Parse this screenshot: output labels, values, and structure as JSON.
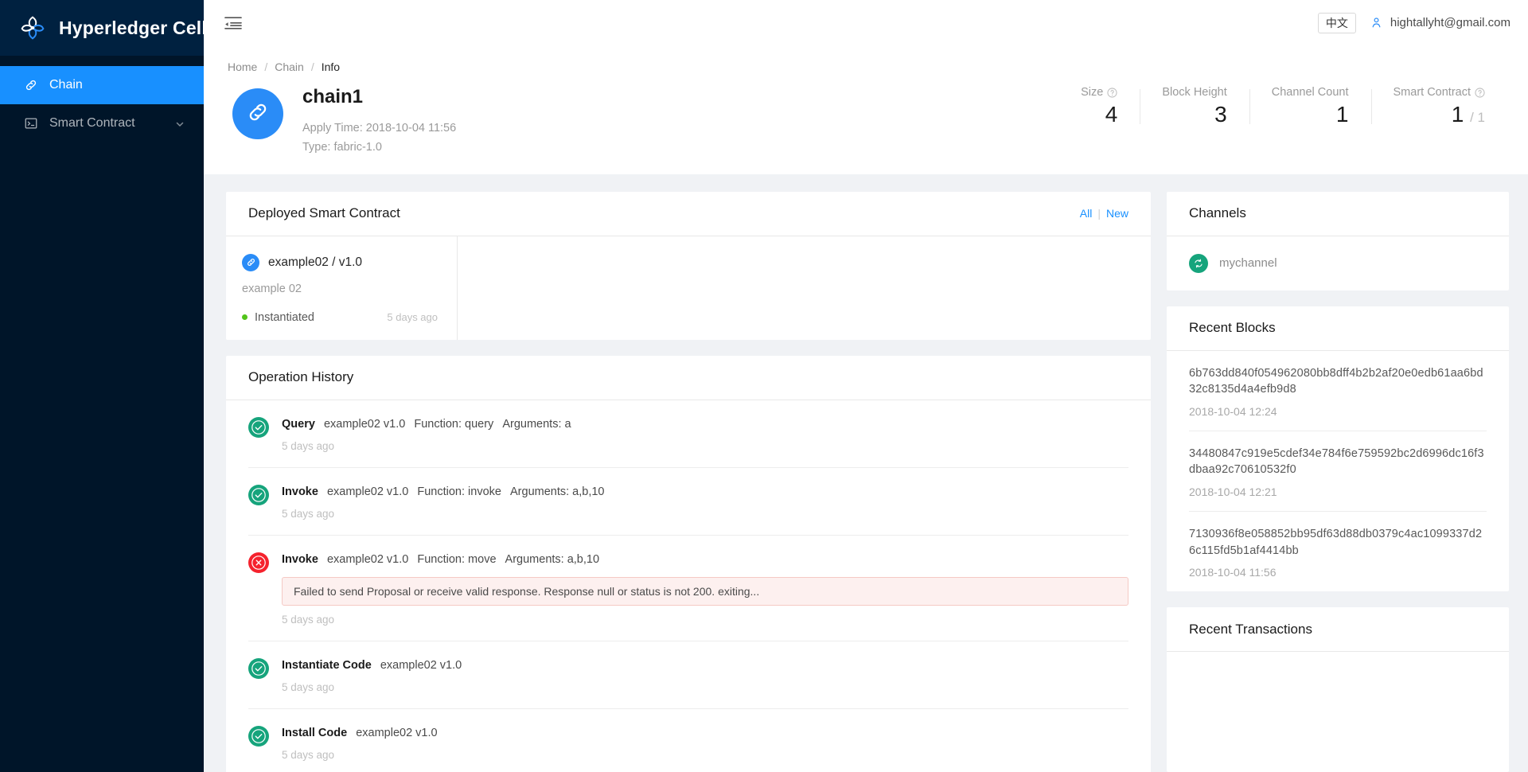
{
  "brand": {
    "title": "Hyperledger Cello",
    "logo_icon": "cello-logo-icon"
  },
  "sidebar": {
    "items": [
      {
        "label": "Chain",
        "icon": "link-icon",
        "active": true
      },
      {
        "label": "Smart Contract",
        "icon": "terminal-icon",
        "active": false,
        "chevron": "chevron-down-icon"
      }
    ]
  },
  "topbar": {
    "menu_icon": "hamburger-menu-icon",
    "lang_label": "中文",
    "user_icon": "user-icon",
    "user_email": "hightallyht@gmail.com"
  },
  "breadcrumb": {
    "items": [
      "Home",
      "Chain",
      "Info"
    ],
    "separator": "/"
  },
  "page_header": {
    "avatar_icon": "link-icon",
    "chain_name": "chain1",
    "apply_time": "Apply Time: 2018-10-04 11:56",
    "type": "Type: fabric-1.0",
    "stats": [
      {
        "label": "Size",
        "help": true,
        "value": "4",
        "sub": ""
      },
      {
        "label": "Block Height",
        "help": false,
        "value": "3",
        "sub": ""
      },
      {
        "label": "Channel Count",
        "help": false,
        "value": "1",
        "sub": ""
      },
      {
        "label": "Smart Contract",
        "help": true,
        "value": "1",
        "sub": "/ 1"
      }
    ]
  },
  "deployed": {
    "title": "Deployed Smart Contract",
    "link_all": "All",
    "link_sep": "|",
    "link_new": "New",
    "items": [
      {
        "icon": "link-icon",
        "name": "example02 / v1.0",
        "description": "example 02",
        "status": "Instantiated",
        "status_color": "#52c41a",
        "time": "5 days ago"
      }
    ]
  },
  "operation_history": {
    "title": "Operation History",
    "items": [
      {
        "icon": "check-circle-icon",
        "state": "success",
        "action": "Query",
        "target": "example02 v1.0",
        "function": "Function: query",
        "arguments": "Arguments: a",
        "error": "",
        "time": "5 days ago"
      },
      {
        "icon": "check-circle-icon",
        "state": "success",
        "action": "Invoke",
        "target": "example02 v1.0",
        "function": "Function: invoke",
        "arguments": "Arguments: a,b,10",
        "error": "",
        "time": "5 days ago"
      },
      {
        "icon": "close-circle-icon",
        "state": "error",
        "action": "Invoke",
        "target": "example02 v1.0",
        "function": "Function: move",
        "arguments": "Arguments: a,b,10",
        "error": "Failed to send Proposal or receive valid response. Response null or status is not 200. exiting...",
        "time": "5 days ago"
      },
      {
        "icon": "check-circle-icon",
        "state": "success",
        "action": "Instantiate Code",
        "target": "example02 v1.0",
        "function": "",
        "arguments": "",
        "error": "",
        "time": "5 days ago"
      },
      {
        "icon": "check-circle-icon",
        "state": "success",
        "action": "Install Code",
        "target": "example02 v1.0",
        "function": "",
        "arguments": "",
        "error": "",
        "time": "5 days ago"
      }
    ]
  },
  "channels": {
    "title": "Channels",
    "items": [
      {
        "icon": "sync-icon",
        "name": "mychannel"
      }
    ]
  },
  "recent_blocks": {
    "title": "Recent Blocks",
    "items": [
      {
        "hash": "6b763dd840f054962080bb8dff4b2b2af20e0edb61aa6bd32c8135d4a4efb9d8",
        "time": "2018-10-04 12:24"
      },
      {
        "hash": "34480847c919e5cdef34e784f6e759592bc2d6996dc16f3dbaa92c70610532f0",
        "time": "2018-10-04 12:21"
      },
      {
        "hash": "7130936f8e058852bb95df63d88db0379c4ac1099337d26c115fd5b1af4414bb",
        "time": "2018-10-04 11:56"
      }
    ]
  },
  "recent_transactions": {
    "title": "Recent Transactions",
    "items": []
  },
  "colors": {
    "sidebar_bg": "#001529",
    "accent": "#1890ff",
    "success": "#16a47c",
    "error": "#f5222d",
    "status_dot": "#52c41a"
  }
}
